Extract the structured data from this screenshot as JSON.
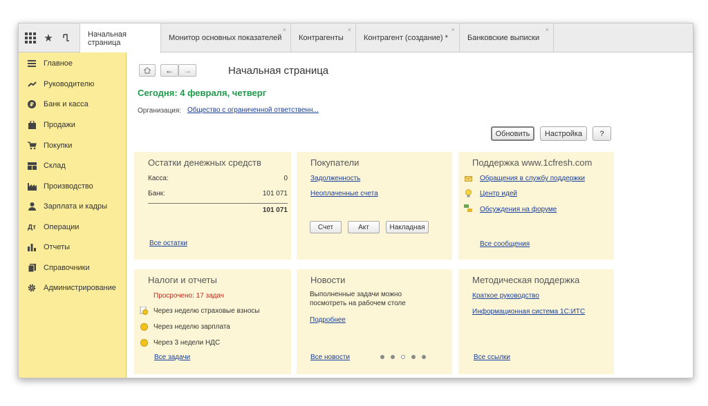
{
  "tabs": [
    {
      "label": "Начальная страница",
      "active": true
    },
    {
      "label": "Монитор основных показателей",
      "closable": true
    },
    {
      "label": "Контрагенты",
      "closable": true
    },
    {
      "label": "Контрагент (создание) *",
      "closable": true
    },
    {
      "label": "Банковские выписки",
      "closable": true
    }
  ],
  "close_glyph": "×",
  "top_icons": [
    "apps-grid-icon",
    "star-icon",
    "history-icon"
  ],
  "sidebar": {
    "items": [
      {
        "label": "Главное",
        "icon": "menu-icon"
      },
      {
        "label": "Руководителю",
        "icon": "trend-icon"
      },
      {
        "label": "Банк и касса",
        "icon": "ruble-icon"
      },
      {
        "label": "Продажи",
        "icon": "bag-icon"
      },
      {
        "label": "Покупки",
        "icon": "cart-icon"
      },
      {
        "label": "Склад",
        "icon": "warehouse-icon"
      },
      {
        "label": "Производство",
        "icon": "factory-icon"
      },
      {
        "label": "Зарплата и кадры",
        "icon": "person-icon"
      },
      {
        "label": "Операции",
        "icon": "operations-icon"
      },
      {
        "label": "Отчеты",
        "icon": "bar-chart-icon"
      },
      {
        "label": "Справочники",
        "icon": "book-icon"
      },
      {
        "label": "Администрирование",
        "icon": "gear-icon"
      }
    ]
  },
  "header": {
    "title": "Начальная страница",
    "today": "Сегодня: 4 февраля, четверг",
    "org_label": "Организация:",
    "org_value": "Общество с ограниченной ответственн...",
    "refresh_label": "Обновить",
    "settings_label": "Настройка",
    "help_label": "?"
  },
  "panels": {
    "cash": {
      "title": "Остатки денежных средств",
      "rows": [
        {
          "label": "Касса:",
          "value": "0"
        },
        {
          "label": "Банк:",
          "value": "101 071"
        }
      ],
      "total": "101 071",
      "link": "Все остатки"
    },
    "buyers": {
      "title": "Покупатели",
      "links": [
        "Задолженность",
        "Неоплаченные счета"
      ],
      "buttons": [
        "Счет",
        "Акт",
        "Накладная"
      ]
    },
    "support": {
      "title": "Поддержка www.1cfresh.com",
      "links": [
        "Обращения в службу поддержки",
        "Центр идей",
        "Обсуждения на форуме"
      ],
      "all_link": "Все сообщения"
    },
    "taxes": {
      "title": "Налоги и отчеты",
      "overdue": "Просрочено: 17 задач",
      "items": [
        "Через неделю страховые взносы",
        "Через неделю зарплата",
        "Через 3 недели НДС"
      ],
      "link": "Все задачи"
    },
    "news": {
      "title": "Новости",
      "text_line1": "Выполненные задачи можно",
      "text_line2": "посмотреть на рабочем столе",
      "more_link": "Подробнее",
      "all_link": "Все новости",
      "dots": [
        false,
        false,
        true,
        false,
        false
      ]
    },
    "method": {
      "title": "Методическая поддержка",
      "links": [
        "Краткое руководство",
        "Информационная система 1С:ИТС"
      ],
      "all_link": "Все ссылки"
    }
  },
  "colors": {
    "sidebar_bg": "#fbec9a",
    "panel_bg": "#fdf6d6",
    "accent_green": "#1d9a4a",
    "link_blue": "#1a3e9c",
    "overdue_red": "#c8261d"
  }
}
